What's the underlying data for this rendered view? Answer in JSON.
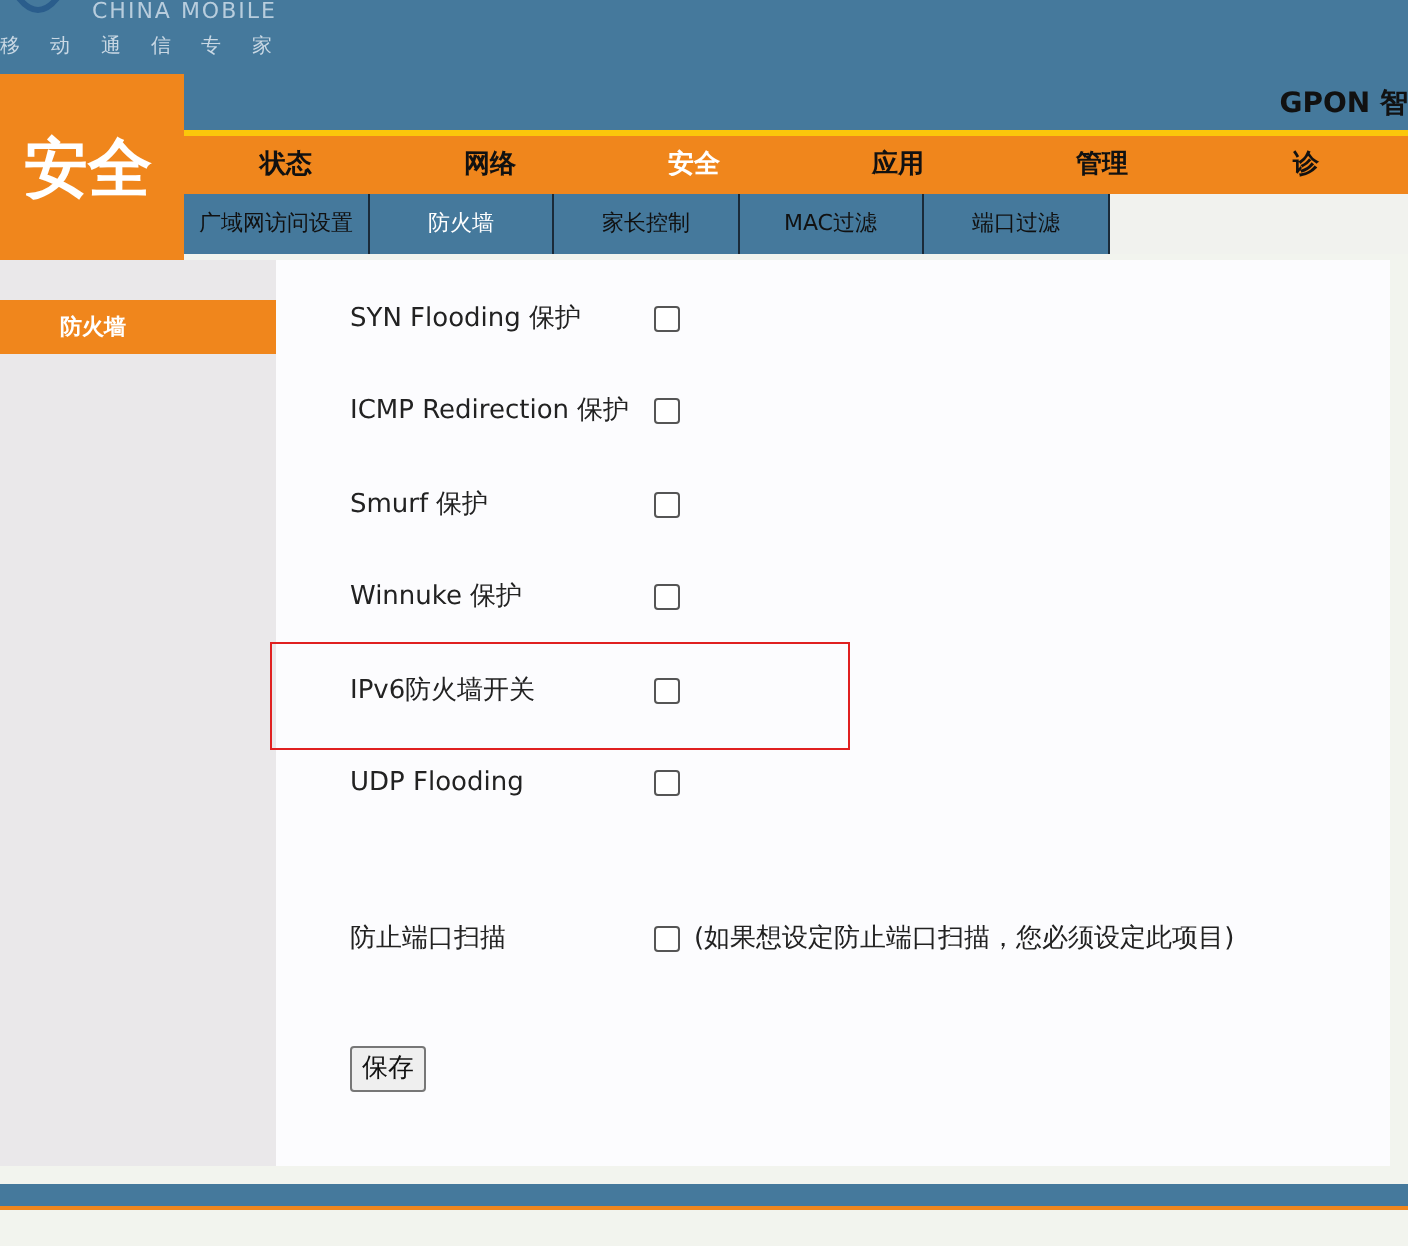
{
  "logo": {
    "brand": "CHINA MOBILE",
    "slogan": "移 动 通 信 专 家"
  },
  "section_title": "安全",
  "product_title": "GPON 智",
  "nav": [
    {
      "label": "状态",
      "selected": false
    },
    {
      "label": "网络",
      "selected": false
    },
    {
      "label": "安全",
      "selected": true
    },
    {
      "label": "应用",
      "selected": false
    },
    {
      "label": "管理",
      "selected": false
    },
    {
      "label": "诊",
      "selected": false
    }
  ],
  "subtabs": [
    {
      "label": "广域网访问设置",
      "selected": false
    },
    {
      "label": "防火墙",
      "selected": true
    },
    {
      "label": "家长控制",
      "selected": false
    },
    {
      "label": "MAC过滤",
      "selected": false
    },
    {
      "label": "端口过滤",
      "selected": false
    }
  ],
  "sidebar": {
    "items": [
      {
        "label": "防火墙",
        "selected": true
      }
    ]
  },
  "options": [
    {
      "label": "SYN Flooding 保护",
      "checked": false,
      "highlighted": false
    },
    {
      "label": "ICMP Redirection 保护",
      "checked": false,
      "highlighted": false
    },
    {
      "label": "Smurf 保护",
      "checked": false,
      "highlighted": false
    },
    {
      "label": "Winnuke 保护",
      "checked": false,
      "highlighted": false
    },
    {
      "label": "IPv6防火墙开关",
      "checked": false,
      "highlighted": true
    },
    {
      "label": "UDP Flooding",
      "checked": false,
      "highlighted": false
    },
    {
      "label": "防止端口扫描",
      "checked": false,
      "highlighted": false,
      "note": "(如果想设定防止端口扫描，您必须设定此项目)"
    }
  ],
  "buttons": [
    "保存"
  ]
}
